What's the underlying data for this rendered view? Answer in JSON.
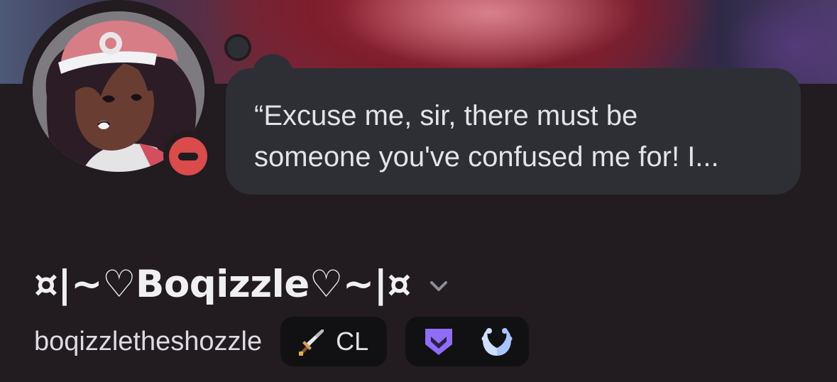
{
  "banner": {
    "colors": {
      "primary": "#87283a",
      "accent": "#d8808c",
      "edge": "#4d5a78"
    }
  },
  "avatar": {
    "icon": "user-avatar-image"
  },
  "status": {
    "presence": "do-not-disturb",
    "presence_color": "#da4b4b",
    "custom_status": "“Excuse me, sir, there must be\nsomeone you've confused me for! I..."
  },
  "profile": {
    "display_name": "¤|~♡Boqizzle♡~|¤",
    "username": "boqizzletheshozzle"
  },
  "guild_tag": {
    "icon": "sword-icon",
    "label": "CL"
  },
  "badges": [
    {
      "icon": "hypesquad-badge-icon",
      "color": "#8f6df6"
    },
    {
      "icon": "laurel-badge-icon",
      "color": "#cfe0ff"
    }
  ],
  "theme": {
    "background": "#221b20",
    "bubble": "#2e2f35",
    "pill": "#111114"
  }
}
